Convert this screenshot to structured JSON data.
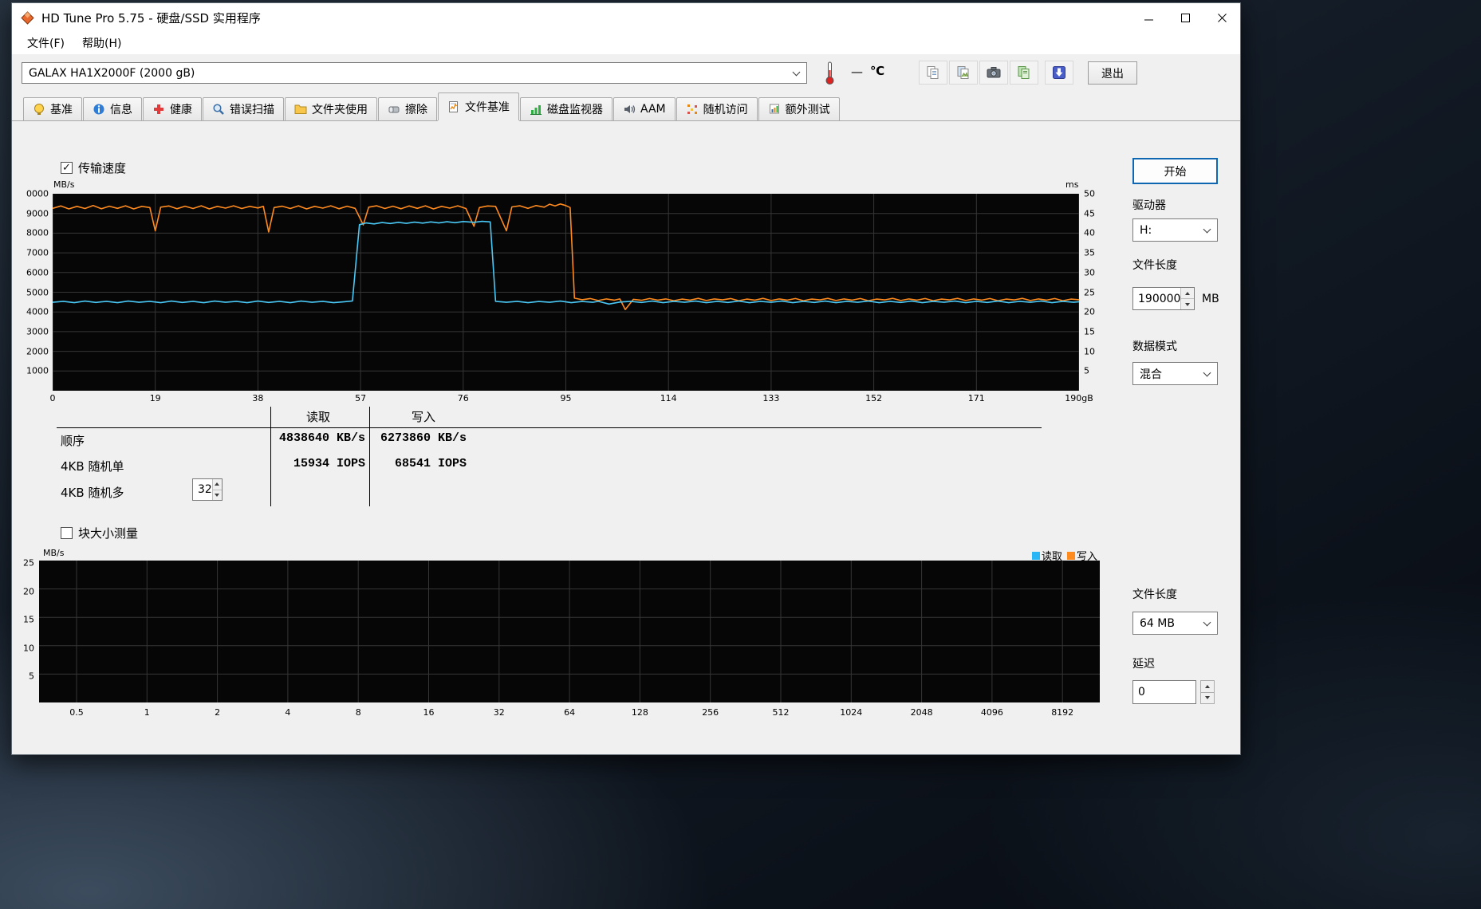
{
  "window": {
    "title": "HD Tune Pro 5.75 - 硬盘/SSD 实用程序"
  },
  "menu": [
    {
      "label": "文件(F)"
    },
    {
      "label": "帮助(H)"
    }
  ],
  "toolbar": {
    "device": "GALAX HA1X2000F (2000 gB)",
    "temp_value": "—",
    "temp_unit": "℃",
    "exit": "退出"
  },
  "tabs": [
    {
      "label": "基准"
    },
    {
      "label": "信息"
    },
    {
      "label": "健康"
    },
    {
      "label": "错误扫描"
    },
    {
      "label": "文件夹使用"
    },
    {
      "label": "擦除"
    },
    {
      "label": "文件基准",
      "active": true
    },
    {
      "label": "磁盘监视器"
    },
    {
      "label": "AAM"
    },
    {
      "label": "随机访问"
    },
    {
      "label": "额外测试"
    }
  ],
  "checkboxes": {
    "transfer_speed": {
      "label": "传输速度",
      "checked": true
    },
    "block_size": {
      "label": "块大小测量",
      "checked": false
    }
  },
  "results": {
    "header": {
      "read": "读取",
      "write": "写入"
    },
    "rows": [
      {
        "label": "顺序",
        "read": "4838640 KB/s",
        "write": "6273860 KB/s"
      },
      {
        "label": "4KB 随机单",
        "read": "15934 IOPS",
        "write": "68541 IOPS"
      },
      {
        "label": "4KB 随机多",
        "read": "",
        "write": ""
      }
    ],
    "queue_depth": "32"
  },
  "controls": {
    "start": "开始",
    "drive_label": "驱动器",
    "drive": "H:",
    "file_length_label": "文件长度",
    "file_length": "190000",
    "file_length_unit": "MB",
    "data_mode_label": "数据模式",
    "data_mode": "混合"
  },
  "block_controls": {
    "file_length_label": "文件长度",
    "file_length": "64 MB",
    "latency_label": "延迟",
    "latency": "0"
  },
  "chart_data": [
    {
      "type": "line",
      "title": "传输速度",
      "xlim": [
        0,
        190
      ],
      "ylim": [
        0,
        10000
      ],
      "y_right_lim": [
        0,
        50
      ],
      "y_left_unit": "MB/s",
      "y_right_unit": "ms",
      "x_ticks": [
        "0",
        "19",
        "38",
        "57",
        "76",
        "95",
        "114",
        "133",
        "152",
        "171",
        "190gB"
      ],
      "y_ticks_left": [
        "0000",
        "9000",
        "8000",
        "7000",
        "6000",
        "5000",
        "4000",
        "3000",
        "2000",
        "1000"
      ],
      "y_ticks_right": [
        "50",
        "45",
        "40",
        "35",
        "30",
        "25",
        "20",
        "15",
        "10",
        "5"
      ],
      "grid": true,
      "series": [
        {
          "name": "写入",
          "color": "#ff8a1e",
          "points": [
            [
              0,
              9260
            ],
            [
              1.5,
              9380
            ],
            [
              3,
              9230
            ],
            [
              4.5,
              9360
            ],
            [
              6,
              9250
            ],
            [
              7.5,
              9400
            ],
            [
              9,
              9240
            ],
            [
              10.5,
              9370
            ],
            [
              12,
              9260
            ],
            [
              13.5,
              9390
            ],
            [
              15,
              9230
            ],
            [
              16.5,
              9360
            ],
            [
              18,
              9300
            ],
            [
              19,
              8120
            ],
            [
              20,
              9320
            ],
            [
              21.5,
              9380
            ],
            [
              23,
              9240
            ],
            [
              24.5,
              9370
            ],
            [
              26,
              9250
            ],
            [
              27.5,
              9390
            ],
            [
              29,
              9230
            ],
            [
              30.5,
              9360
            ],
            [
              32,
              9270
            ],
            [
              33.5,
              9390
            ],
            [
              35,
              9250
            ],
            [
              36.5,
              9360
            ],
            [
              38,
              9280
            ],
            [
              39,
              9360
            ],
            [
              40,
              8060
            ],
            [
              41,
              9300
            ],
            [
              42.5,
              9370
            ],
            [
              44,
              9250
            ],
            [
              45.5,
              9390
            ],
            [
              47,
              9230
            ],
            [
              48.5,
              9360
            ],
            [
              50,
              9270
            ],
            [
              51.5,
              9390
            ],
            [
              53,
              9240
            ],
            [
              54.5,
              9370
            ],
            [
              56,
              9260
            ],
            [
              57.5,
              8420
            ],
            [
              58.5,
              9320
            ],
            [
              60,
              9390
            ],
            [
              61.5,
              9250
            ],
            [
              63,
              9370
            ],
            [
              64.5,
              9240
            ],
            [
              66,
              9380
            ],
            [
              67.5,
              9260
            ],
            [
              69,
              9390
            ],
            [
              70.5,
              9230
            ],
            [
              72,
              9360
            ],
            [
              73.5,
              9270
            ],
            [
              75,
              9390
            ],
            [
              76.5,
              9250
            ],
            [
              78,
              8350
            ],
            [
              79,
              9300
            ],
            [
              80.5,
              9380
            ],
            [
              82,
              9360
            ],
            [
              84,
              8120
            ],
            [
              85,
              9330
            ],
            [
              86.5,
              9390
            ],
            [
              88,
              9260
            ],
            [
              89.5,
              9400
            ],
            [
              91,
              9320
            ],
            [
              92,
              9470
            ],
            [
              93,
              9380
            ],
            [
              94,
              9480
            ],
            [
              95,
              9400
            ],
            [
              95.8,
              9300
            ],
            [
              96.6,
              4700
            ],
            [
              98,
              4620
            ],
            [
              99.5,
              4680
            ],
            [
              101,
              4580
            ],
            [
              102.5,
              4660
            ],
            [
              104,
              4600
            ],
            [
              105,
              4660
            ],
            [
              106,
              4120
            ],
            [
              107.5,
              4640
            ],
            [
              109,
              4590
            ],
            [
              110.5,
              4680
            ],
            [
              112,
              4600
            ],
            [
              113.5,
              4660
            ],
            [
              115,
              4570
            ],
            [
              116.5,
              4650
            ],
            [
              118,
              4600
            ],
            [
              119.5,
              4690
            ],
            [
              121,
              4580
            ],
            [
              122.5,
              4660
            ],
            [
              124,
              4610
            ],
            [
              125.5,
              4680
            ],
            [
              127,
              4570
            ],
            [
              128.5,
              4650
            ],
            [
              130,
              4600
            ],
            [
              131.5,
              4690
            ],
            [
              133,
              4580
            ],
            [
              134.5,
              4660
            ],
            [
              136,
              4600
            ],
            [
              137.5,
              4680
            ],
            [
              139,
              4570
            ],
            [
              140.5,
              4650
            ],
            [
              142,
              4610
            ],
            [
              143.5,
              4690
            ],
            [
              145,
              4580
            ],
            [
              146.5,
              4660
            ],
            [
              148,
              4600
            ],
            [
              149.5,
              4680
            ],
            [
              151,
              4570
            ],
            [
              152.5,
              4650
            ],
            [
              154,
              4610
            ],
            [
              155.5,
              4690
            ],
            [
              157,
              4580
            ],
            [
              158.5,
              4660
            ],
            [
              160,
              4600
            ],
            [
              161.5,
              4680
            ],
            [
              163,
              4570
            ],
            [
              164.5,
              4650
            ],
            [
              166,
              4610
            ],
            [
              167.5,
              4690
            ],
            [
              169,
              4580
            ],
            [
              170.5,
              4660
            ],
            [
              172,
              4600
            ],
            [
              173.5,
              4680
            ],
            [
              175,
              4570
            ],
            [
              176.5,
              4650
            ],
            [
              178,
              4610
            ],
            [
              179.5,
              4690
            ],
            [
              181,
              4580
            ],
            [
              182.5,
              4660
            ],
            [
              184,
              4600
            ],
            [
              185.5,
              4680
            ],
            [
              187,
              4570
            ],
            [
              188.5,
              4650
            ],
            [
              190,
              4620
            ]
          ]
        },
        {
          "name": "读取",
          "color": "#4ac8f5",
          "points": [
            [
              0,
              4490
            ],
            [
              2,
              4540
            ],
            [
              4,
              4470
            ],
            [
              6,
              4550
            ],
            [
              8,
              4480
            ],
            [
              10,
              4540
            ],
            [
              12,
              4470
            ],
            [
              14,
              4550
            ],
            [
              16,
              4490
            ],
            [
              18,
              4540
            ],
            [
              20,
              4470
            ],
            [
              22,
              4550
            ],
            [
              24,
              4480
            ],
            [
              26,
              4540
            ],
            [
              28,
              4470
            ],
            [
              30,
              4550
            ],
            [
              32,
              4490
            ],
            [
              34,
              4540
            ],
            [
              36,
              4470
            ],
            [
              38,
              4550
            ],
            [
              40,
              4480
            ],
            [
              42,
              4540
            ],
            [
              44,
              4470
            ],
            [
              46,
              4550
            ],
            [
              48,
              4490
            ],
            [
              50,
              4540
            ],
            [
              52,
              4470
            ],
            [
              54,
              4520
            ],
            [
              55.5,
              4560
            ],
            [
              56.8,
              8430
            ],
            [
              58,
              8520
            ],
            [
              59.5,
              8470
            ],
            [
              61,
              8540
            ],
            [
              62.5,
              8490
            ],
            [
              64,
              8550
            ],
            [
              65.5,
              8500
            ],
            [
              67,
              8560
            ],
            [
              68.5,
              8510
            ],
            [
              70,
              8570
            ],
            [
              71.5,
              8520
            ],
            [
              73,
              8580
            ],
            [
              74.5,
              8530
            ],
            [
              76,
              8590
            ],
            [
              78,
              8550
            ],
            [
              79.5,
              8600
            ],
            [
              81,
              8570
            ],
            [
              82,
              4540
            ],
            [
              84,
              4490
            ],
            [
              86,
              4540
            ],
            [
              88,
              4470
            ],
            [
              90,
              4530
            ],
            [
              92,
              4490
            ],
            [
              94,
              4550
            ],
            [
              96,
              4470
            ],
            [
              98,
              4530
            ],
            [
              100,
              4490
            ],
            [
              101,
              4540
            ],
            [
              103,
              4400
            ],
            [
              105,
              4500
            ],
            [
              107,
              4540
            ],
            [
              109,
              4480
            ],
            [
              111,
              4550
            ],
            [
              113,
              4470
            ],
            [
              115,
              4540
            ],
            [
              117,
              4490
            ],
            [
              119,
              4550
            ],
            [
              121,
              4470
            ],
            [
              123,
              4540
            ],
            [
              125,
              4480
            ],
            [
              127,
              4550
            ],
            [
              129,
              4470
            ],
            [
              131,
              4540
            ],
            [
              133,
              4490
            ],
            [
              135,
              4550
            ],
            [
              137,
              4470
            ],
            [
              139,
              4540
            ],
            [
              141,
              4480
            ],
            [
              143,
              4550
            ],
            [
              145,
              4470
            ],
            [
              147,
              4540
            ],
            [
              149,
              4490
            ],
            [
              151,
              4550
            ],
            [
              153,
              4470
            ],
            [
              155,
              4540
            ],
            [
              157,
              4480
            ],
            [
              159,
              4550
            ],
            [
              161,
              4470
            ],
            [
              163,
              4540
            ],
            [
              165,
              4490
            ],
            [
              167,
              4550
            ],
            [
              169,
              4470
            ],
            [
              171,
              4540
            ],
            [
              173,
              4480
            ],
            [
              175,
              4550
            ],
            [
              177,
              4470
            ],
            [
              179,
              4540
            ],
            [
              181,
              4490
            ],
            [
              183,
              4550
            ],
            [
              185,
              4470
            ],
            [
              187,
              4540
            ],
            [
              189,
              4490
            ],
            [
              190,
              4520
            ]
          ]
        }
      ]
    },
    {
      "type": "line",
      "title": "块大小测量",
      "ylim": [
        0,
        25
      ],
      "y_unit": "MB/s",
      "x_ticks": [
        "0.5",
        "1",
        "2",
        "4",
        "8",
        "16",
        "32",
        "64",
        "128",
        "256",
        "512",
        "1024",
        "2048",
        "4096",
        "8192"
      ],
      "y_ticks": [
        "25",
        "20",
        "15",
        "10",
        "5"
      ],
      "legend": [
        {
          "label": "读取",
          "color": "#29b6f6"
        },
        {
          "label": "写入",
          "color": "#ff8a1e"
        }
      ],
      "series": []
    }
  ]
}
